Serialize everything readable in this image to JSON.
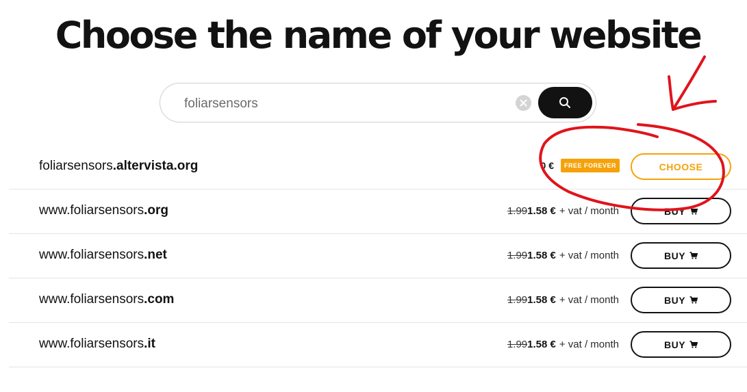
{
  "page": {
    "title": "Choose the name of your website"
  },
  "search": {
    "value": "foliarsensors",
    "placeholder": "",
    "clear_icon": "close-icon",
    "search_icon": "search-icon"
  },
  "results": [
    {
      "prefix": "foliarsensors",
      "extension": ".altervista.org",
      "free_price": "0 €",
      "badge": "FREE FOREVER",
      "button": "CHOOSE"
    },
    {
      "prefix": "www.foliarsensors",
      "extension": ".org",
      "old_price": "1.99",
      "new_price": "1.58 €",
      "suffix": "+ vat / month",
      "button": "BUY"
    },
    {
      "prefix": "www.foliarsensors",
      "extension": ".net",
      "old_price": "1.99",
      "new_price": "1.58 €",
      "suffix": "+ vat / month",
      "button": "BUY"
    },
    {
      "prefix": "www.foliarsensors",
      "extension": ".com",
      "old_price": "1.99",
      "new_price": "1.58 €",
      "suffix": "+ vat / month",
      "button": "BUY"
    },
    {
      "prefix": "www.foliarsensors",
      "extension": ".it",
      "old_price": "1.99",
      "new_price": "1.58 €",
      "suffix": "+ vat / month",
      "button": "BUY"
    }
  ],
  "colors": {
    "accent_orange": "#f5a20a",
    "dark": "#121212",
    "annotation_red": "#e0141b"
  }
}
